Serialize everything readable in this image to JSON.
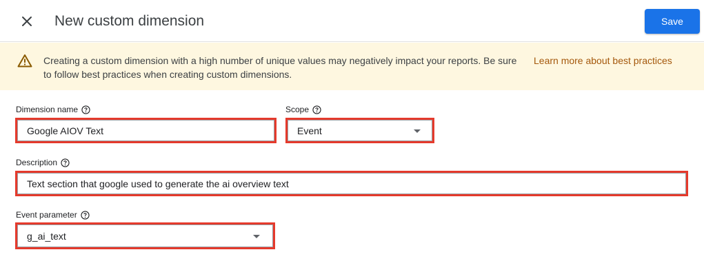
{
  "header": {
    "title": "New custom dimension",
    "save_label": "Save",
    "close_icon": "close-icon"
  },
  "banner": {
    "icon": "warning-icon",
    "message": "Creating a custom dimension with a high number of unique values may negatively impact your reports. Be sure to follow best practices when creating custom dimensions.",
    "link": "Learn more about best practices",
    "background": "#fef7e0",
    "link_color": "#a4570b"
  },
  "form": {
    "dimension_name": {
      "label": "Dimension name",
      "value": "Google AIOV Text"
    },
    "scope": {
      "label": "Scope",
      "value": "Event"
    },
    "description": {
      "label": "Description",
      "value": "Text section that google used to generate the ai overview text"
    },
    "event_parameter": {
      "label": "Event parameter",
      "value": "g_ai_text"
    }
  },
  "colors": {
    "accent": "#1a73e8",
    "highlight_border": "#e53a2c"
  }
}
